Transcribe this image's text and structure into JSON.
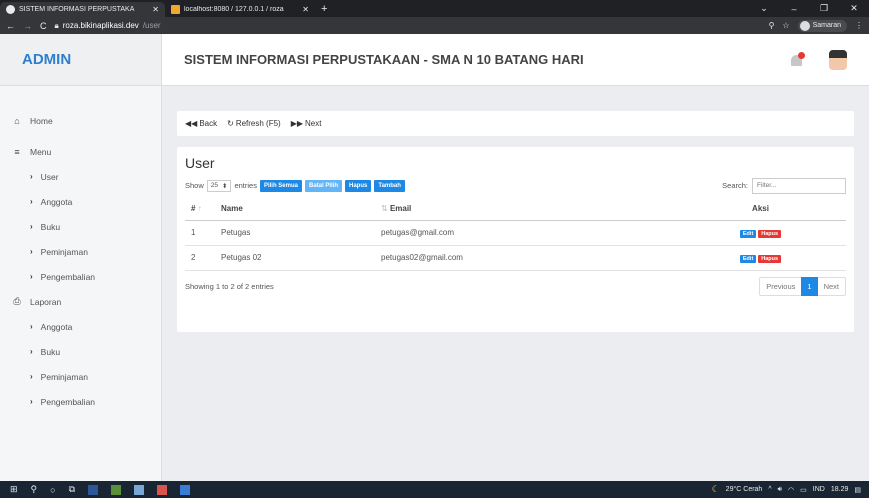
{
  "browser": {
    "tabs": [
      {
        "title": "SISTEM INFORMASI PERPUSTAKA",
        "active": true
      },
      {
        "title": "localhost:8080 / 127.0.0.1 / roza",
        "active": false
      }
    ],
    "new_tab": "+",
    "url_host": "roza.bikinaplikasi.dev",
    "url_path": "/user",
    "profile_name": "Samaran"
  },
  "header": {
    "brand": "ADMIN",
    "title": "SISTEM INFORMASI PERPUSTAKAAN - SMA N 10 BATANG HARI"
  },
  "sidebar": {
    "home": "Home",
    "menu": "Menu",
    "menu_items": [
      "User",
      "Anggota",
      "Buku",
      "Peminjaman",
      "Pengembalian"
    ],
    "laporan": "Laporan",
    "laporan_items": [
      "Anggota",
      "Buku",
      "Peminjaman",
      "Pengembalian"
    ]
  },
  "toolbar": {
    "back": "Back",
    "refresh": "Refresh (F5)",
    "next": "Next"
  },
  "card": {
    "title": "User",
    "show_label": "Show",
    "entries_value": "25",
    "entries_label": "entries",
    "buttons": {
      "pilih_semua": "Pilih Semua",
      "batal_pilih": "Batal Pilih",
      "hapus": "Hapus",
      "tambah": "Tambah"
    },
    "search_label": "Search:",
    "search_placeholder": "Filter..."
  },
  "table": {
    "columns": [
      "#",
      "Name",
      "Email",
      "Aksi"
    ],
    "rows": [
      {
        "no": "1",
        "name": "Petugas",
        "email": "petugas@gmail.com"
      },
      {
        "no": "2",
        "name": "Petugas 02",
        "email": "petugas02@gmail.com"
      }
    ],
    "edit_label": "Edit",
    "hapus_label": "Hapus",
    "info": "Showing 1 to 2 of 2 entries",
    "pagination": {
      "previous": "Previous",
      "current": "1",
      "next": "Next"
    }
  },
  "taskbar": {
    "weather": "29°C Cerah",
    "lang": "IND",
    "time": "18.29"
  },
  "colors": {
    "accent": "#1e88e5",
    "danger": "#e53935",
    "brand": "#2f7fcf"
  }
}
